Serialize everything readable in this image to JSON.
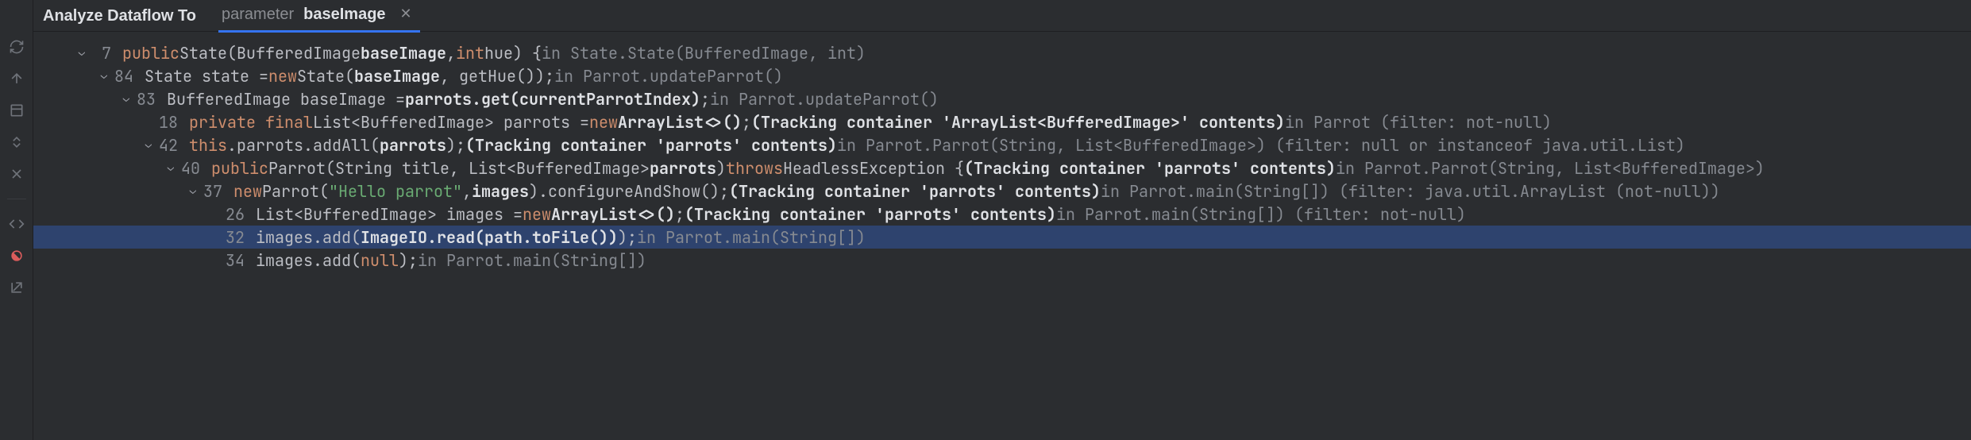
{
  "header": {
    "title": "Analyze Dataflow To"
  },
  "tab": {
    "prefix": "parameter",
    "name": "baseImage"
  },
  "rows": [
    {
      "indent": 0,
      "chev": true,
      "ln": "7",
      "segs": [
        {
          "t": "public",
          "c": "kw"
        },
        {
          "t": " State(BufferedImage ",
          "c": "txt"
        },
        {
          "t": "baseImage",
          "c": "param"
        },
        {
          "t": ", ",
          "c": "txt"
        },
        {
          "t": "int",
          "c": "kw"
        },
        {
          "t": " hue) {",
          "c": "txt"
        },
        {
          "t": " in State.State(BufferedImage, int)",
          "c": "loc"
        }
      ]
    },
    {
      "indent": 1,
      "chev": true,
      "ln": "84",
      "segs": [
        {
          "t": "State state = ",
          "c": "txt"
        },
        {
          "t": "new",
          "c": "kw"
        },
        {
          "t": " State(",
          "c": "txt"
        },
        {
          "t": "baseImage",
          "c": "param"
        },
        {
          "t": ", getHue());",
          "c": "txt"
        },
        {
          "t": " in Parrot.updateParrot()",
          "c": "loc"
        }
      ]
    },
    {
      "indent": 2,
      "chev": true,
      "ln": "83",
      "segs": [
        {
          "t": "BufferedImage baseImage = ",
          "c": "txt"
        },
        {
          "t": "parrots.get(currentParrotIndex)",
          "c": "fn"
        },
        {
          "t": ";",
          "c": "semi"
        },
        {
          "t": " in Parrot.updateParrot()",
          "c": "loc"
        }
      ]
    },
    {
      "indent": 3,
      "chev": false,
      "ln": "18",
      "segs": [
        {
          "t": "private final",
          "c": "kw"
        },
        {
          "t": " List<BufferedImage> parrots = ",
          "c": "txt"
        },
        {
          "t": "new",
          "c": "kw"
        },
        {
          "t": " ",
          "c": "txt"
        },
        {
          "t": "ArrayList<>()",
          "c": "fn"
        },
        {
          "t": ";",
          "c": "semi"
        },
        {
          "t": " (Tracking container 'ArrayList<BufferedImage>' contents)",
          "c": "note"
        },
        {
          "t": " in Parrot (filter: not-null)",
          "c": "loc"
        }
      ]
    },
    {
      "indent": 3,
      "chev": true,
      "ln": "42",
      "segs": [
        {
          "t": "this",
          "c": "kw"
        },
        {
          "t": ".parrots.addAll(",
          "c": "txt"
        },
        {
          "t": "parrots",
          "c": "param"
        },
        {
          "t": ");",
          "c": "txt"
        },
        {
          "t": " (Tracking container 'parrots' contents)",
          "c": "note"
        },
        {
          "t": " in Parrot.Parrot(String, List<BufferedImage>) (filter: null or instanceof java.util.List)",
          "c": "loc"
        }
      ]
    },
    {
      "indent": 4,
      "chev": true,
      "ln": "40",
      "segs": [
        {
          "t": "public",
          "c": "kw"
        },
        {
          "t": " Parrot(String title, List<BufferedImage> ",
          "c": "txt"
        },
        {
          "t": "parrots",
          "c": "param"
        },
        {
          "t": ") ",
          "c": "txt"
        },
        {
          "t": "throws",
          "c": "kw"
        },
        {
          "t": " HeadlessException {",
          "c": "txt"
        },
        {
          "t": " (Tracking container 'parrots' contents)",
          "c": "note"
        },
        {
          "t": " in Parrot.Parrot(String, List<BufferedImage>)",
          "c": "loc"
        }
      ]
    },
    {
      "indent": 5,
      "chev": true,
      "ln": "37",
      "segs": [
        {
          "t": "new",
          "c": "kw"
        },
        {
          "t": " Parrot(",
          "c": "txt"
        },
        {
          "t": "\"Hello parrot\"",
          "c": "str"
        },
        {
          "t": ", ",
          "c": "txt"
        },
        {
          "t": "images",
          "c": "param"
        },
        {
          "t": ").configureAndShow();",
          "c": "txt"
        },
        {
          "t": " (Tracking container 'parrots' contents)",
          "c": "note"
        },
        {
          "t": " in Parrot.main(String[]) (filter: java.util.ArrayList (not-null))",
          "c": "loc"
        }
      ]
    },
    {
      "indent": 6,
      "chev": false,
      "ln": "26",
      "segs": [
        {
          "t": "List<BufferedImage> images = ",
          "c": "txt"
        },
        {
          "t": "new",
          "c": "kw"
        },
        {
          "t": " ",
          "c": "txt"
        },
        {
          "t": "ArrayList<>()",
          "c": "fn"
        },
        {
          "t": ";",
          "c": "semi"
        },
        {
          "t": " (Tracking container 'parrots' contents)",
          "c": "note"
        },
        {
          "t": " in Parrot.main(String[]) (filter: not-null)",
          "c": "loc"
        }
      ]
    },
    {
      "indent": 6,
      "chev": false,
      "ln": "32",
      "selected": true,
      "segs": [
        {
          "t": "images.add(",
          "c": "txt"
        },
        {
          "t": "ImageIO.read(path.toFile())",
          "c": "fn"
        },
        {
          "t": ");",
          "c": "semi"
        },
        {
          "t": " in Parrot.main(String[])",
          "c": "loc"
        }
      ]
    },
    {
      "indent": 6,
      "chev": false,
      "ln": "34",
      "segs": [
        {
          "t": "images.add(",
          "c": "txt"
        },
        {
          "t": "null",
          "c": "kw"
        },
        {
          "t": ");",
          "c": "txt"
        },
        {
          "t": " in Parrot.main(String[])",
          "c": "loc"
        }
      ]
    }
  ]
}
